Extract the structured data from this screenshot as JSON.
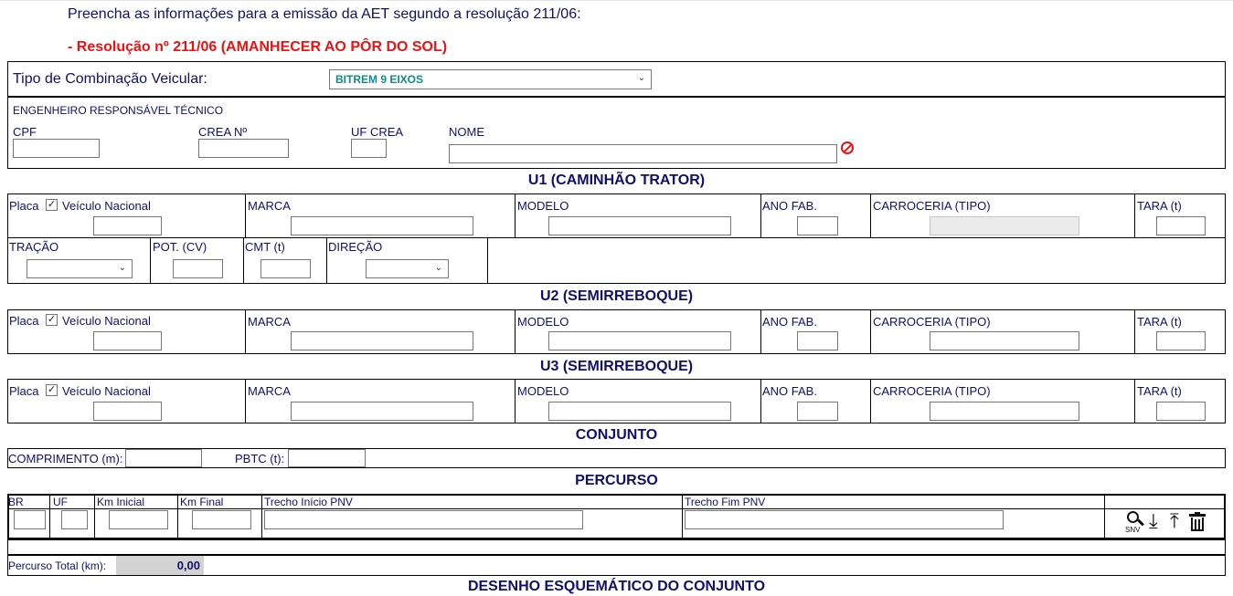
{
  "intro": "Preencha as informações para a emissão da AET segundo a resolução 211/06:",
  "resolution": "- Resolução nº 211/06 (AMANHECER AO PÔR DO SOL)",
  "combo": {
    "label": "Tipo de Combinação Veicular:",
    "value": "BITREM 9 EIXOS"
  },
  "engineer": {
    "title": "ENGENHEIRO RESPONSÁVEL TÉCNICO",
    "cpf": "CPF",
    "crea": "CREA Nº",
    "uf": "UF CREA",
    "nome": "NOME"
  },
  "u1": {
    "title": "U1 (CAMINHÃO TRATOR)",
    "placa": "Placa",
    "nacional": "Veículo Nacional",
    "marca": "MARCA",
    "modelo": "MODELO",
    "ano": "ANO FAB.",
    "carroceria": "CARROCERIA (TIPO)",
    "tara": "TARA (t)",
    "tracao": "TRAÇÃO",
    "pot": "POT. (CV)",
    "cmt": "CMT (t)",
    "direcao": "DIREÇÃO"
  },
  "u2": {
    "title": "U2 (SEMIRREBOQUE)",
    "placa": "Placa",
    "nacional": "Veículo Nacional",
    "marca": "MARCA",
    "modelo": "MODELO",
    "ano": "ANO FAB.",
    "carroceria": "CARROCERIA (TIPO)",
    "tara": "TARA (t)"
  },
  "u3": {
    "title": "U3 (SEMIRREBOQUE)",
    "placa": "Placa",
    "nacional": "Veículo Nacional",
    "marca": "MARCA",
    "modelo": "MODELO",
    "ano": "ANO FAB.",
    "carroceria": "CARROCERIA (TIPO)",
    "tara": "TARA (t)"
  },
  "conjunto": {
    "title": "CONJUNTO",
    "comprimento": "COMPRIMENTO (m):",
    "pbtc": "PBTC (t):"
  },
  "percurso": {
    "title": "PERCURSO",
    "headers": [
      "BR",
      "UF",
      "Km Inicial",
      "Km Final",
      "Trecho Início PNV",
      "Trecho Fim PNV"
    ],
    "snv_label": "SNV",
    "total_label": "Percurso Total (km):",
    "total_value": "0,00"
  },
  "desenho": {
    "title": "DESENHO ESQUEMÁTICO DO CONJUNTO"
  },
  "icons": {
    "clear": "clear-icon",
    "search": "search-snv-icon",
    "download": "download-icon",
    "upload": "upload-icon",
    "delete": "trash-icon"
  }
}
